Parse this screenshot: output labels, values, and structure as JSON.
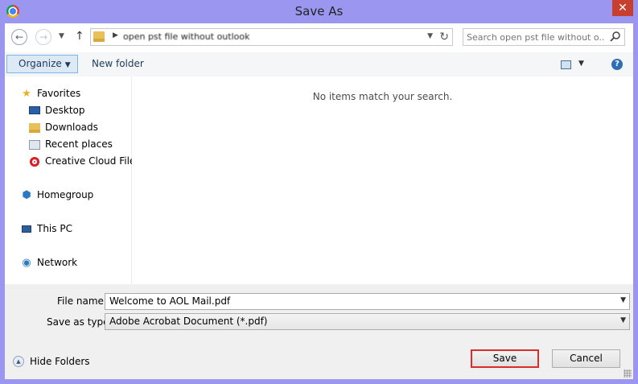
{
  "window": {
    "title": "Save As",
    "close_symbol": "✕",
    "app_icon": "chrome-icon"
  },
  "navigation": {
    "back_symbol": "←",
    "forward_symbol": "→",
    "up_symbol": "↑",
    "address_text": "open pst file without outlook",
    "search_placeholder": "Search open pst file without o..."
  },
  "toolbar": {
    "organize_label": "Organize",
    "new_folder_label": "New folder",
    "help_symbol": "?"
  },
  "sidebar": {
    "items": [
      {
        "label": "Favorites",
        "icon": "star-icon"
      },
      {
        "label": "Desktop",
        "icon": "desktop-icon"
      },
      {
        "label": "Downloads",
        "icon": "downloads-icon"
      },
      {
        "label": "Recent places",
        "icon": "recent-places-icon"
      },
      {
        "label": "Creative Cloud Files",
        "icon": "creative-cloud-icon"
      },
      {
        "label": "Homegroup",
        "icon": "homegroup-icon"
      },
      {
        "label": "This PC",
        "icon": "computer-icon"
      },
      {
        "label": "Network",
        "icon": "network-icon"
      }
    ]
  },
  "content": {
    "empty_message": "No items match your search."
  },
  "form": {
    "file_name_label": "File name:",
    "file_name_value": "Welcome to AOL Mail.pdf",
    "save_type_label": "Save as type:",
    "save_type_value": "Adobe Acrobat Document (*.pdf)",
    "hide_folders_label": "Hide Folders",
    "save_label": "Save",
    "cancel_label": "Cancel"
  },
  "colors": {
    "frame": "#9b97f0",
    "close_button": "#c7402f",
    "highlight_border": "#d92c2c",
    "organize_bg": "#dde9f5"
  }
}
